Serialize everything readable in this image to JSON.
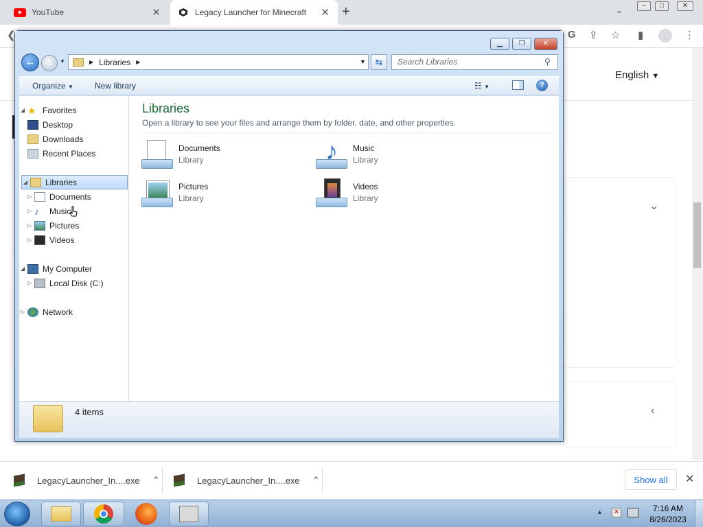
{
  "browser": {
    "tabs": [
      {
        "label": "YouTube"
      },
      {
        "label": "Legacy Launcher for Minecraft"
      }
    ],
    "new_tab": "+",
    "caption_controls": [
      "–",
      "□",
      "✕"
    ]
  },
  "page": {
    "language": "English"
  },
  "explorer": {
    "address": {
      "crumb": "Libraries"
    },
    "search_placeholder": "Search Libraries",
    "commands": {
      "organize": "Organize",
      "new_library": "New library"
    },
    "nav": {
      "favorites": "Favorites",
      "desktop": "Desktop",
      "downloads": "Downloads",
      "recent": "Recent Places",
      "libraries": "Libraries",
      "documents": "Documents",
      "music": "Music",
      "pictures": "Pictures",
      "videos": "Videos",
      "computer": "My Computer",
      "local_disk": "Local Disk (C:)",
      "network": "Network"
    },
    "content": {
      "title": "Libraries",
      "subtitle": "Open a library to see your files and arrange them by folder, date, and other properties.",
      "libraries": [
        {
          "name": "Documents",
          "kind": "Library"
        },
        {
          "name": "Music",
          "kind": "Library"
        },
        {
          "name": "Pictures",
          "kind": "Library"
        },
        {
          "name": "Videos",
          "kind": "Library"
        }
      ]
    },
    "status": "4 items"
  },
  "downloads": {
    "items": [
      {
        "file": "LegacyLauncher_In....exe"
      },
      {
        "file": "LegacyLauncher_In....exe"
      }
    ],
    "show_all": "Show all"
  },
  "taskbar": {
    "time": "7:16 AM",
    "date": "8/26/2023"
  }
}
